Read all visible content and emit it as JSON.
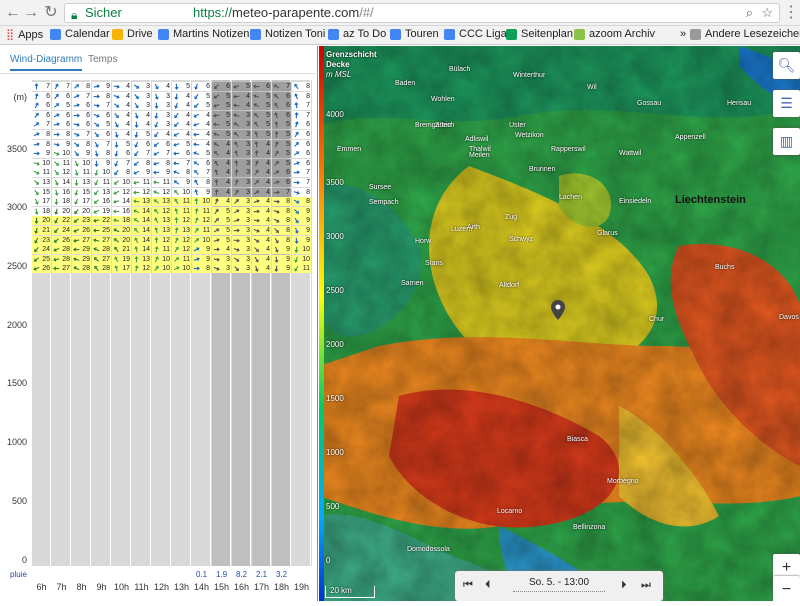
{
  "browser": {
    "secure_label": "Sicher",
    "url_scheme": "https://",
    "url_host": "meteo-parapente.com",
    "url_rest": "/#/"
  },
  "bookmarks": {
    "apps": "Apps",
    "items": [
      "Calendar",
      "Drive",
      "Martins Notizen",
      "Notizen Toni",
      "az To Do",
      "Touren",
      "CCC Liga",
      "Seitenplan",
      "azoom Archiv"
    ],
    "overflow": "»",
    "other": "Andere Lesezeichen"
  },
  "panel": {
    "tabs": [
      "Wind-Diagramm",
      "Temps"
    ],
    "unit": "(m)",
    "y_labels": [
      "3500",
      "3000",
      "2500",
      "2000",
      "1500",
      "1000",
      "500",
      "0"
    ],
    "hours": [
      "6h",
      "7h",
      "8h",
      "9h",
      "10h",
      "11h",
      "12h",
      "13h",
      "14h",
      "15h",
      "16h",
      "17h",
      "18h",
      "19h"
    ],
    "rain_label": "pluie",
    "rain": [
      "",
      "",
      "",
      "",
      "",
      "",
      "",
      "",
      "0.1",
      "1.9",
      "8.2",
      "2.1",
      "3.2",
      ""
    ],
    "wind_speeds": [
      [
        "7",
        "6",
        "6",
        "6",
        "7",
        "8",
        "8",
        "9",
        "10",
        "11",
        "13",
        "15",
        "17",
        "18",
        "20",
        "21",
        "23",
        "24",
        "25",
        "26"
      ],
      [
        "7",
        "6",
        "5",
        "6",
        "6",
        "8",
        "9",
        "10",
        "11",
        "12",
        "14",
        "16",
        "18",
        "20",
        "22",
        "24",
        "26",
        "28",
        "28",
        "27"
      ],
      [
        "8",
        "7",
        "6",
        "6",
        "6",
        "7",
        "8",
        "9",
        "10",
        "11",
        "13",
        "15",
        "17",
        "20",
        "23",
        "26",
        "27",
        "29",
        "29",
        "28"
      ],
      [
        "9",
        "8",
        "7",
        "6",
        "5",
        "6",
        "7",
        "8",
        "9",
        "10",
        "11",
        "13",
        "16",
        "19",
        "22",
        "25",
        "27",
        "28",
        "27",
        "28"
      ],
      [
        "4",
        "4",
        "4",
        "4",
        "4",
        "4",
        "5",
        "6",
        "7",
        "8",
        "10",
        "12",
        "14",
        "16",
        "18",
        "20",
        "20",
        "21",
        "19",
        "17"
      ],
      [
        "3",
        "3",
        "3",
        "4",
        "4",
        "5",
        "6",
        "7",
        "8",
        "9",
        "11",
        "12",
        "13",
        "14",
        "14",
        "14",
        "14",
        "14",
        "13",
        "12"
      ],
      [
        "4",
        "3",
        "3",
        "3",
        "3",
        "4",
        "6",
        "7",
        "8",
        "9",
        "11",
        "12",
        "13",
        "12",
        "13",
        "13",
        "12",
        "11",
        "10",
        "10"
      ],
      [
        "5",
        "4",
        "4",
        "4",
        "4",
        "4",
        "5",
        "6",
        "7",
        "8",
        "9",
        "10",
        "11",
        "11",
        "12",
        "13",
        "12",
        "12",
        "11",
        "10"
      ],
      [
        "6",
        "5",
        "5",
        "4",
        "4",
        "4",
        "4",
        "5",
        "6",
        "7",
        "8",
        "9",
        "10",
        "11",
        "12",
        "11",
        "10",
        "9",
        "9",
        "8"
      ],
      [
        "6",
        "5",
        "5",
        "5",
        "5",
        "5",
        "4",
        "4",
        "4",
        "4",
        "4",
        "4",
        "4",
        "5",
        "5",
        "5",
        "5",
        "4",
        "3",
        "3"
      ],
      [
        "5",
        "4",
        "4",
        "3",
        "3",
        "3",
        "3",
        "3",
        "3",
        "3",
        "3",
        "3",
        "3",
        "3",
        "3",
        "3",
        "3",
        "3",
        "3",
        "3"
      ],
      [
        "6",
        "5",
        "5",
        "5",
        "5",
        "5",
        "4",
        "4",
        "4",
        "4",
        "4",
        "4",
        "4",
        "4",
        "4",
        "4",
        "4",
        "4",
        "4",
        "4"
      ],
      [
        "7",
        "6",
        "6",
        "6",
        "5",
        "5",
        "5",
        "5",
        "5",
        "6",
        "6",
        "7",
        "8",
        "8",
        "8",
        "8",
        "8",
        "9",
        "9",
        "9"
      ],
      [
        "8",
        "8",
        "7",
        "7",
        "6",
        "6",
        "6",
        "6",
        "6",
        "7",
        "7",
        "8",
        "8",
        "9",
        "9",
        "9",
        "9",
        "10",
        "10",
        "11"
      ]
    ]
  },
  "map": {
    "title_line1": "Grenzschicht",
    "title_line2": "Decke",
    "title_line3": "m MSL",
    "alt_labels": [
      "4000",
      "3500",
      "3000",
      "2500",
      "2000",
      "1500",
      "1000",
      "500",
      "0"
    ],
    "country": "Liechtenstein",
    "places": [
      "Baden",
      "Bülach",
      "Winterthur",
      "Wil",
      "Zürich",
      "Uster",
      "Wetzikon",
      "Rapperswil",
      "Zug",
      "Luzern",
      "Schwyz",
      "Glarus",
      "Altdorf",
      "Chur",
      "Davos",
      "Sursee",
      "Sempach",
      "Horw",
      "Stans",
      "Sarnen",
      "Appenzell",
      "Gossau",
      "Wattwil",
      "Emmen",
      "Arth",
      "Brunnen",
      "Bremgarten",
      "Wohlen",
      "Adliswil",
      "Thalwil",
      "Meilen",
      "Herisau",
      "Buchs",
      "Bellinzona",
      "Locarno",
      "Morbegno",
      "Domodossola",
      "Biasca",
      "Einsiedeln",
      "Lachen"
    ],
    "scale": "20 km",
    "time_label": "So. 5. - 13:00",
    "zoom_in": "+",
    "zoom_out": "−"
  },
  "colors": {
    "accent": "#337ab7",
    "secure": "#0a8043",
    "rain": "#1f4ab0"
  }
}
